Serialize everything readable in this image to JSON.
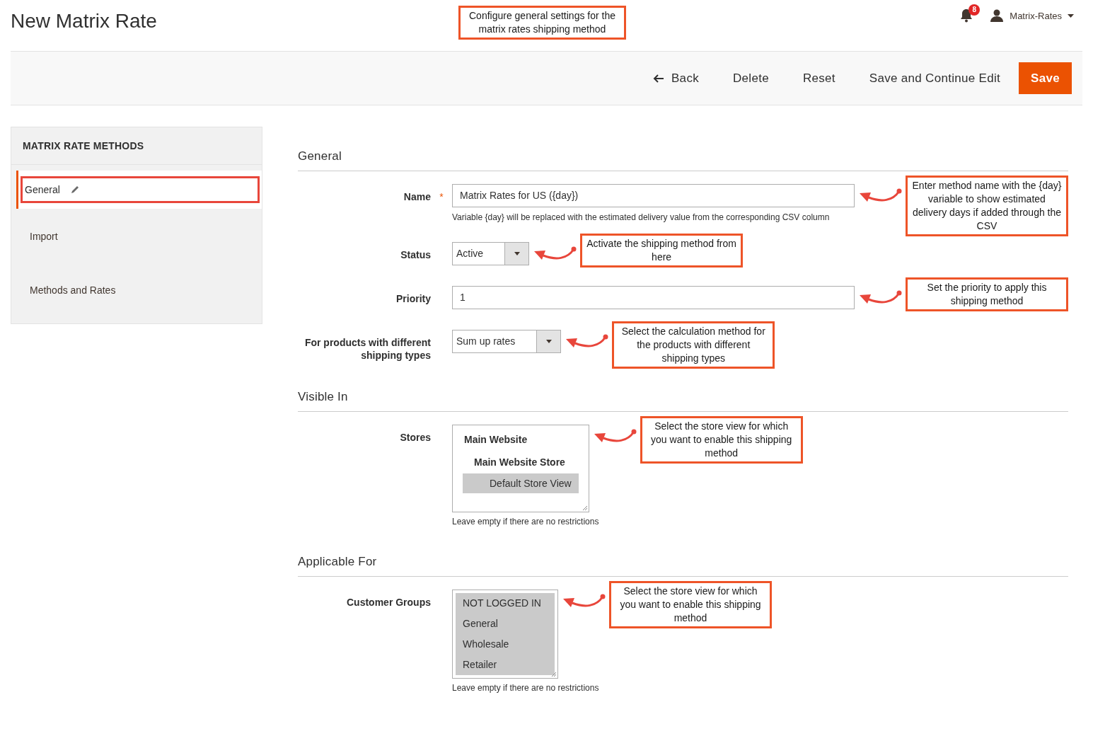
{
  "page_title": "New Matrix Rate",
  "header_callout": "Configure general settings for the matrix rates shipping method",
  "notifications": {
    "count": "8"
  },
  "user": {
    "name": "Matrix-Rates"
  },
  "actions": [
    {
      "label": "Back",
      "kind": "back"
    },
    {
      "label": "Delete",
      "kind": "plain"
    },
    {
      "label": "Reset",
      "kind": "plain"
    },
    {
      "label": "Save and Continue Edit",
      "kind": "plain"
    },
    {
      "label": "Save",
      "kind": "primary"
    }
  ],
  "sidebar": {
    "title": "MATRIX RATE METHODS",
    "items": [
      {
        "label": "General",
        "selected": true,
        "highlighted": true,
        "editable": true
      },
      {
        "label": "Import",
        "selected": false,
        "highlighted": false,
        "editable": false
      },
      {
        "label": "Methods and Rates",
        "selected": false,
        "highlighted": false,
        "editable": false
      }
    ]
  },
  "sections": [
    {
      "title": "General",
      "fields": [
        {
          "label": "Name",
          "kind": "text",
          "required_mark": "*",
          "value": "Matrix Rates for US ({day})",
          "note": "Variable {day} will be replaced with the estimated delivery value from the corresponding CSV column",
          "callout": "Enter method name with the {day} variable to show estimated delivery days if added through the CSV"
        },
        {
          "label": "Status",
          "kind": "select",
          "value": "Active",
          "callout": "Activate the shipping method from here"
        },
        {
          "label": "Priority",
          "kind": "text",
          "value": "1",
          "callout": "Set the priority to apply this shipping method"
        },
        {
          "label": "For products with different shipping types",
          "kind": "select",
          "value": "Sum up rates",
          "callout": "Select the calculation method for the products with different shipping types"
        }
      ]
    },
    {
      "title": "Visible In",
      "fields": [
        {
          "label": "Stores",
          "kind": "multiselect",
          "note": "Leave empty if there are no restrictions",
          "callout": "Select the store view for which you want to enable this shipping method",
          "options": [
            {
              "label": "Main Website",
              "selected": false,
              "children": [
                {
                  "label": "Main Website Store",
                  "selected": false,
                  "children": [
                    {
                      "label": "Default Store View",
                      "selected": true
                    }
                  ]
                }
              ]
            }
          ]
        }
      ]
    },
    {
      "title": "Applicable For",
      "fields": [
        {
          "label": "Customer Groups",
          "kind": "multiselect",
          "note": "Leave empty if there are no restrictions",
          "callout": "Select the store view for which you want to enable this shipping method",
          "options": [
            {
              "label": "NOT LOGGED IN",
              "selected": true
            },
            {
              "label": "General",
              "selected": true
            },
            {
              "label": "Wholesale",
              "selected": true
            },
            {
              "label": "Retailer",
              "selected": true
            }
          ]
        }
      ]
    }
  ]
}
